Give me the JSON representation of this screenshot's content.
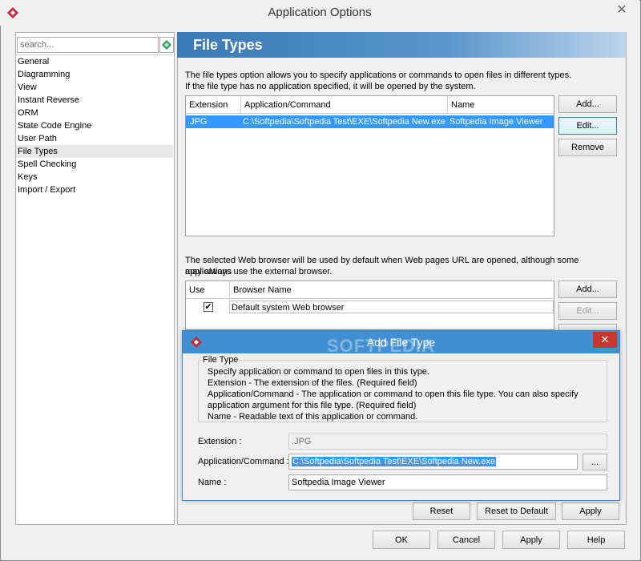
{
  "window": {
    "title": "Application Options",
    "close_glyph": "✕"
  },
  "search": {
    "placeholder": "search..."
  },
  "nav": {
    "items": [
      {
        "label": "General"
      },
      {
        "label": "Diagramming"
      },
      {
        "label": "View"
      },
      {
        "label": "Instant Reverse"
      },
      {
        "label": "ORM"
      },
      {
        "label": "State Code Engine"
      },
      {
        "label": "User Path"
      },
      {
        "label": "File Types",
        "selected": true
      },
      {
        "label": "Spell Checking"
      },
      {
        "label": "Keys"
      },
      {
        "label": "Import / Export"
      }
    ]
  },
  "header": {
    "title": "File Types"
  },
  "file_types": {
    "description_line1": "The file types option allows you to specify applications or commands to open files in different types.",
    "description_line2": "If the file type has no application specified, it will be opened by the system.",
    "columns": [
      "Extension",
      "Application/Command",
      "Name"
    ],
    "rows": [
      {
        "extension": ".JPG",
        "command": "C:\\Softpedia\\Softpedia Test\\EXE\\Softpedia New.exe",
        "name": "Softpedia Image Viewer"
      }
    ],
    "add_label": "Add...",
    "edit_label": "Edit...",
    "remove_label": "Remove"
  },
  "browser": {
    "description_line1": "The selected Web browser will be used by default when Web pages URL are opened, although some applications",
    "description_line2": "may always use the external browser.",
    "columns": [
      "Use",
      "Browser Name"
    ],
    "rows": [
      {
        "checked": true,
        "check_glyph": "✔",
        "name": "Default system Web browser"
      }
    ],
    "add_label": "Add...",
    "edit_label": "Edit..."
  },
  "dialog": {
    "title": "Add File Type",
    "close_glyph": "✕",
    "watermark": "SOFTPEDIA",
    "group_label": "File Type",
    "info_lines": [
      "Specify application or command to open files in this type.",
      "Extension - The extension of the files. (Required field)",
      "Application/Command - The application or command to open this file type. You can also specify",
      "application argument for this file type. (Required field)",
      "Name - Readable text of this application or command."
    ],
    "extension_label": "Extension :",
    "extension_value": ".JPG",
    "command_label": "Application/Command :",
    "command_value": "C:\\Softpedia\\Softpedia Test\\EXE\\Softpedia New.exe",
    "browse_label": "...",
    "name_label": "Name :",
    "name_value": "Softpedia Image Viewer"
  },
  "panel_buttons": {
    "reset": "Reset",
    "reset_default": "Reset to Default",
    "apply": "Apply"
  },
  "footer_buttons": {
    "ok": "OK",
    "cancel": "Cancel",
    "apply": "Apply",
    "help": "Help"
  },
  "colors": {
    "accent": "#3f8fd2",
    "selection": "#3399ff",
    "close_red": "#c7372f",
    "logo_red": "#c8292b"
  }
}
